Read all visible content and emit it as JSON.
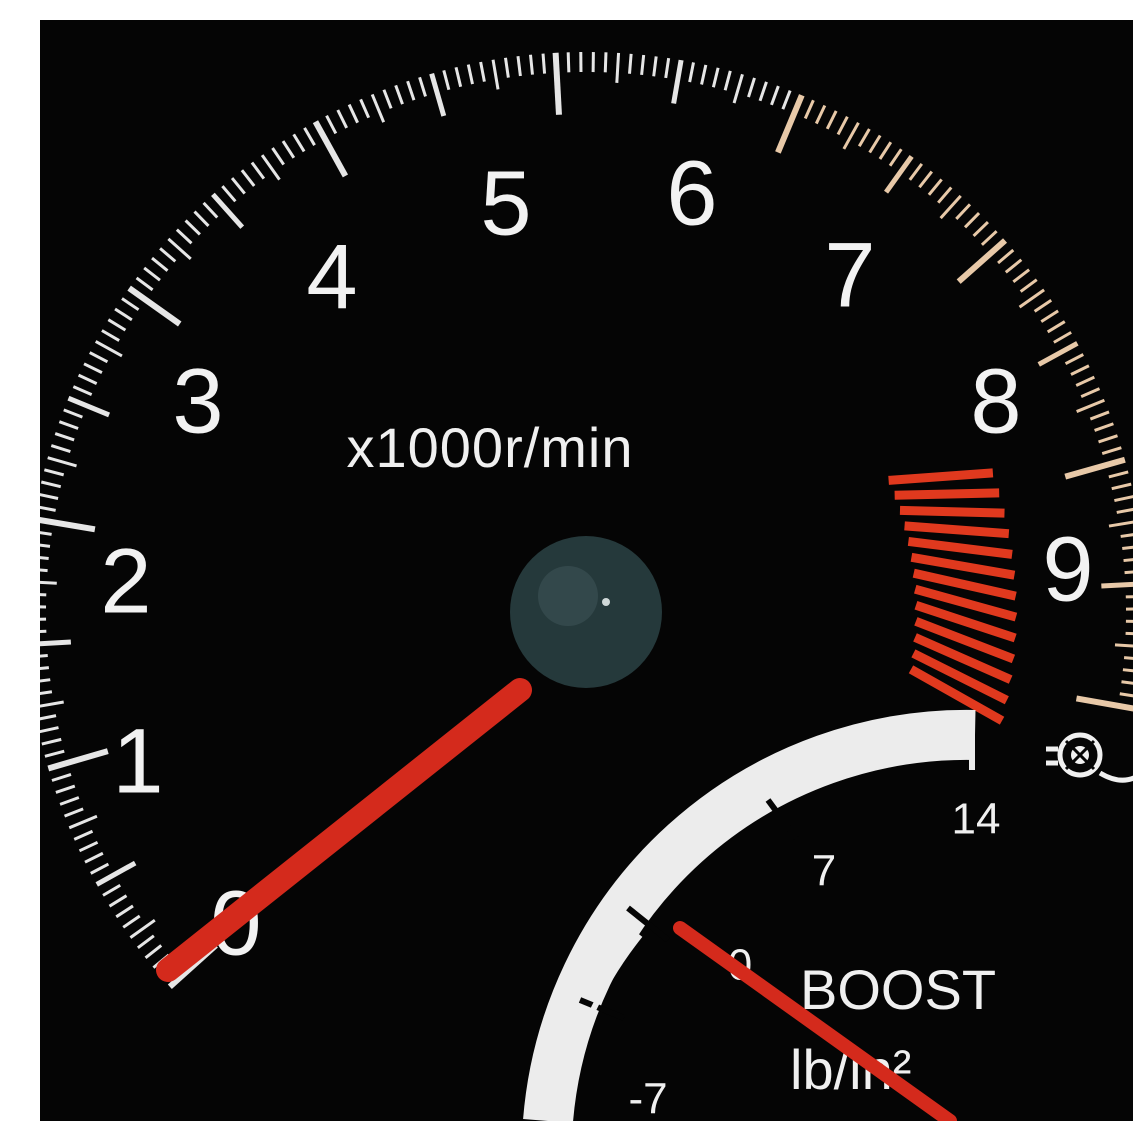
{
  "tachometer": {
    "unit_label": "x1000r/min",
    "scale_numbers": [
      "0",
      "1",
      "2",
      "3",
      "4",
      "5",
      "6",
      "7",
      "8",
      "9"
    ],
    "needle_reading": 0,
    "redline_start": 7.7,
    "redline_end": 9,
    "needle_color": "#d42a1c",
    "redline_color": "#e0391e"
  },
  "boost_gauge": {
    "label": "BOOST",
    "unit": "lb/in²",
    "scale_numbers": [
      "-7",
      "0",
      "7",
      "14"
    ],
    "needle_reading": -1,
    "icon": "turbo-icon"
  },
  "colors": {
    "dial_face": "#050505",
    "markings": "#f2f2f2",
    "hub": "#2a3a3c"
  }
}
